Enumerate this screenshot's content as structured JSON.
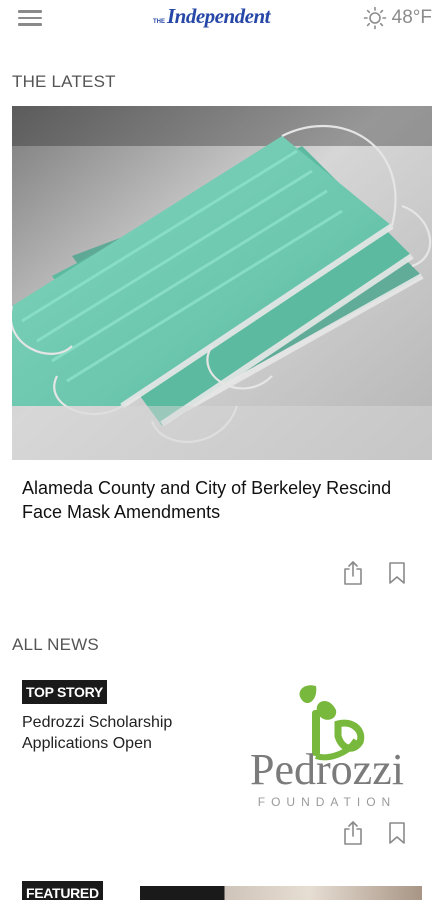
{
  "header": {
    "logo_prefix": "THE",
    "logo_name": "Independent",
    "weather_icon": "sun-icon",
    "temperature": "48°F"
  },
  "latest": {
    "section_title": "THE LATEST",
    "headline": "Alameda County and City of Berkeley Rescind Face Mask Amendments"
  },
  "all_news": {
    "section_title": "ALL NEWS",
    "stories": [
      {
        "badge": "TOP STORY",
        "title": "Pedrozzi Scholarship Applications Open",
        "logo_name": "Pedrozzi",
        "logo_sub": "FOUNDATION"
      },
      {
        "badge": "FEATURED"
      }
    ]
  },
  "colors": {
    "brand": "#2747a8",
    "badge_bg": "#1a1a1a",
    "icon_gray": "#8a8a8a",
    "pedrozzi_green": "#78b83c"
  }
}
